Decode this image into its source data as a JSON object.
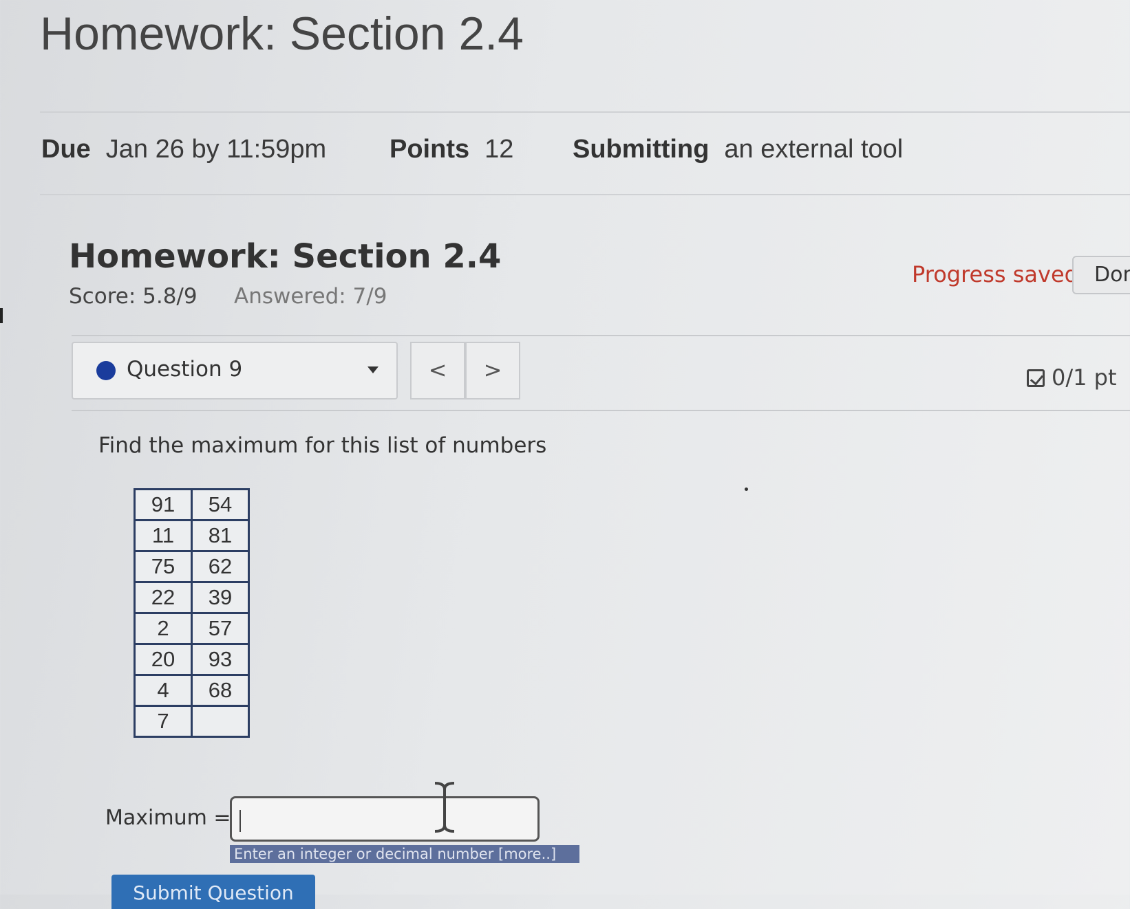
{
  "page": {
    "title": "Homework: Section 2.4"
  },
  "details": {
    "due_label": "Due",
    "due_value": "Jan 26 by 11:59pm",
    "points_label": "Points",
    "points_value": "12",
    "submitting_label": "Submitting",
    "submitting_value": "an external tool"
  },
  "assignment": {
    "title": "Homework: Section 2.4",
    "score": "Score: 5.8/9",
    "answered": "Answered: 7/9",
    "progress_status": "Progress saved",
    "done_label": "Don"
  },
  "question_nav": {
    "selected": "Question 9",
    "prev_symbol": "<",
    "next_symbol": ">",
    "points": "0/1 pt",
    "status_color": "#1a3c9c"
  },
  "question": {
    "prompt": "Find the maximum for this list of numbers",
    "numbers": [
      [
        "91",
        "54"
      ],
      [
        "11",
        "81"
      ],
      [
        "75",
        "62"
      ],
      [
        "22",
        "39"
      ],
      [
        "2",
        "57"
      ],
      [
        "20",
        "93"
      ],
      [
        "4",
        "68"
      ],
      [
        "7",
        ""
      ]
    ]
  },
  "answer": {
    "label": "Maximum =",
    "value": "",
    "hint": "Enter an integer or decimal number [more..]",
    "submit_label": "Submit Question"
  },
  "colors": {
    "progress_saved": "#c0392b",
    "submit_button": "#2f6fb5",
    "hint_background": "#5d6f9c"
  }
}
